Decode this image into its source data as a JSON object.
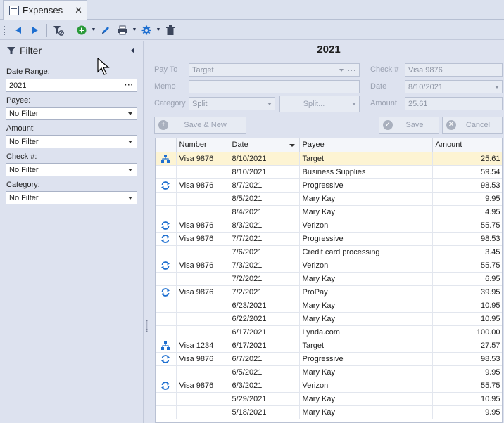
{
  "tab": {
    "title": "Expenses",
    "close": "✕"
  },
  "toolbar": {
    "icons": [
      "back-icon",
      "forward-icon",
      "clear-filter-icon",
      "add-icon",
      "edit-icon",
      "print-icon",
      "settings-icon",
      "delete-icon"
    ]
  },
  "filter": {
    "title": "Filter",
    "date_range_label": "Date Range:",
    "date_range_value": "2021",
    "date_range_button": "···",
    "payee_label": "Payee:",
    "payee_value": "No Filter",
    "amount_label": "Amount:",
    "amount_value": "No Filter",
    "check_label": "Check #:",
    "check_value": "No Filter",
    "category_label": "Category:",
    "category_value": "No Filter"
  },
  "detail": {
    "year": "2021",
    "payto_label": "Pay To",
    "payto_value": "Target",
    "memo_label": "Memo",
    "memo_value": "",
    "category_label": "Category",
    "category_value": "Split",
    "split_button": "Split...",
    "check_label": "Check #",
    "check_value": "Visa 9876",
    "date_label": "Date",
    "date_value": "8/10/2021",
    "amount_label": "Amount",
    "amount_value": "25.61",
    "save_new_button": "Save & New",
    "save_button": "Save",
    "cancel_button": "Cancel"
  },
  "grid": {
    "columns": [
      "Number",
      "Date",
      "Payee",
      "Amount"
    ],
    "rows": [
      {
        "icon": "split-icon",
        "number": "Visa 9876",
        "date": "8/10/2021",
        "payee": "Target",
        "amount": "25.61",
        "selected": true
      },
      {
        "icon": "",
        "number": "",
        "date": "8/10/2021",
        "payee": "Business Supplies",
        "amount": "59.54"
      },
      {
        "icon": "recurring-icon",
        "number": "Visa 9876",
        "date": "8/7/2021",
        "payee": "Progressive",
        "amount": "98.53"
      },
      {
        "icon": "",
        "number": "",
        "date": "8/5/2021",
        "payee": "Mary Kay",
        "amount": "9.95"
      },
      {
        "icon": "",
        "number": "",
        "date": "8/4/2021",
        "payee": "Mary Kay",
        "amount": "4.95"
      },
      {
        "icon": "recurring-icon",
        "number": "Visa 9876",
        "date": "8/3/2021",
        "payee": "Verizon",
        "amount": "55.75"
      },
      {
        "icon": "recurring-icon",
        "number": "Visa 9876",
        "date": "7/7/2021",
        "payee": "Progressive",
        "amount": "98.53"
      },
      {
        "icon": "",
        "number": "",
        "date": "7/6/2021",
        "payee": "Credit card processing",
        "amount": "3.45"
      },
      {
        "icon": "recurring-icon",
        "number": "Visa 9876",
        "date": "7/3/2021",
        "payee": "Verizon",
        "amount": "55.75"
      },
      {
        "icon": "",
        "number": "",
        "date": "7/2/2021",
        "payee": "Mary Kay",
        "amount": "6.95"
      },
      {
        "icon": "recurring-icon",
        "number": "Visa 9876",
        "date": "7/2/2021",
        "payee": "ProPay",
        "amount": "39.95"
      },
      {
        "icon": "",
        "number": "",
        "date": "6/23/2021",
        "payee": "Mary Kay",
        "amount": "10.95"
      },
      {
        "icon": "",
        "number": "",
        "date": "6/22/2021",
        "payee": "Mary Kay",
        "amount": "10.95"
      },
      {
        "icon": "",
        "number": "",
        "date": "6/17/2021",
        "payee": "Lynda.com",
        "amount": "100.00"
      },
      {
        "icon": "split-icon",
        "number": "Visa 1234",
        "date": "6/17/2021",
        "payee": "Target",
        "amount": "27.57"
      },
      {
        "icon": "recurring-icon",
        "number": "Visa 9876",
        "date": "6/7/2021",
        "payee": "Progressive",
        "amount": "98.53"
      },
      {
        "icon": "",
        "number": "",
        "date": "6/5/2021",
        "payee": "Mary Kay",
        "amount": "9.95"
      },
      {
        "icon": "recurring-icon",
        "number": "Visa 9876",
        "date": "6/3/2021",
        "payee": "Verizon",
        "amount": "55.75"
      },
      {
        "icon": "",
        "number": "",
        "date": "5/29/2021",
        "payee": "Mary Kay",
        "amount": "10.95"
      },
      {
        "icon": "",
        "number": "",
        "date": "5/18/2021",
        "payee": "Mary Kay",
        "amount": "9.95"
      }
    ]
  },
  "colors": {
    "accent": "#1e6fd0",
    "selected_row": "#fdf4d3",
    "add_green": "#2a9a3a"
  }
}
